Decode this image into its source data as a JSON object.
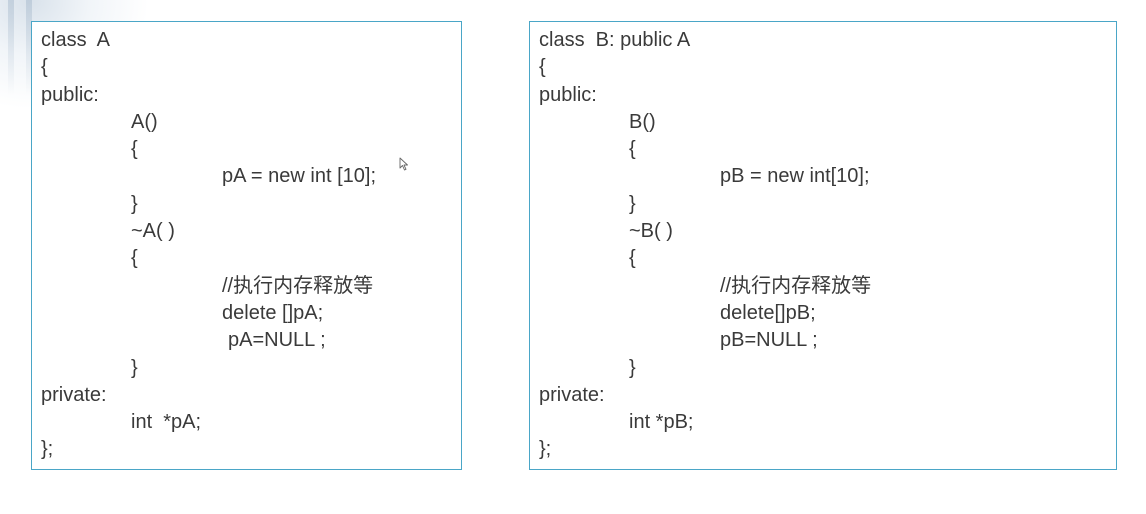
{
  "class_a": {
    "lines": [
      "class  A",
      "{",
      "public:",
      "A()",
      "{",
      "pA = new int [10];",
      "}",
      "~A( )",
      "{",
      "//执行内存释放等",
      "delete []pA;",
      "pA=NULL ;",
      "}",
      "private:",
      "int  *pA;",
      "};"
    ]
  },
  "class_b": {
    "lines": [
      "class  B: public A",
      "{",
      "public:",
      "B()",
      "{",
      "pB = new int[10];",
      "}",
      "~B( )",
      "{",
      "//执行内存释放等",
      "delete[]pB;",
      "pB=NULL ;",
      "}",
      "private:",
      "int *pB;",
      "};"
    ]
  },
  "colors": {
    "border": "#4aa6c7",
    "text": "#3a3a3a"
  },
  "icons": {
    "cursor": "mouse-pointer-icon"
  }
}
